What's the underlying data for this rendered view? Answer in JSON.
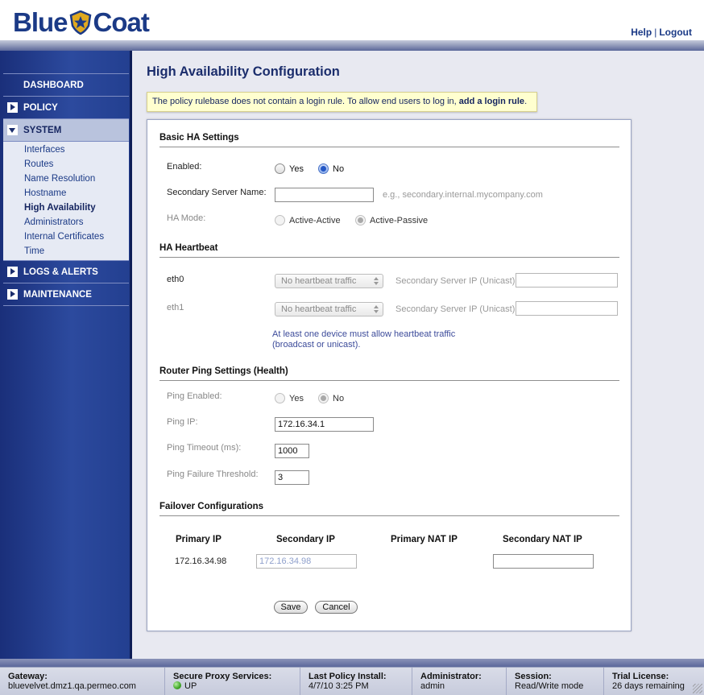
{
  "header": {
    "brand_part1": "Blue",
    "brand_part2": "Coat",
    "links": {
      "help": "Help",
      "separator": "|",
      "logout": "Logout"
    }
  },
  "sidebar": {
    "dashboard": "DASHBOARD",
    "policy": "POLICY",
    "system": "SYSTEM",
    "system_items": [
      "Interfaces",
      "Routes",
      "Name Resolution",
      "Hostname",
      "High Availability",
      "Administrators",
      "Internal Certificates",
      "Time"
    ],
    "current_item": "High Availability",
    "logs_alerts": "LOGS & ALERTS",
    "maintenance": "MAINTENANCE"
  },
  "page": {
    "title": "High Availability Configuration",
    "notice_text": "The policy rulebase does not contain a login rule. To allow end users to log in, ",
    "notice_link": "add a login rule",
    "notice_end": "."
  },
  "basic": {
    "title": "Basic HA Settings",
    "enabled_label": "Enabled:",
    "yes": "Yes",
    "no": "No",
    "enabled_value": "No",
    "secondary_label": "Secondary Server Name:",
    "secondary_value": "",
    "secondary_hint": "e.g., secondary.internal.mycompany.com",
    "mode_label": "HA Mode:",
    "mode_active_active": "Active-Active",
    "mode_active_passive": "Active-Passive",
    "mode_value": "Active-Passive"
  },
  "heartbeat": {
    "title": "HA Heartbeat",
    "eth0": "eth0",
    "eth1": "eth1",
    "select_value": "No heartbeat traffic",
    "secondary_ip_label": "Secondary Server IP (Unicast)",
    "note_line1": "At least one device must allow heartbeat traffic",
    "note_line2": "(broadcast or unicast)."
  },
  "router_ping": {
    "title": "Router Ping Settings (Health)",
    "enabled_label": "Ping Enabled:",
    "yes": "Yes",
    "no": "No",
    "enabled_value": "No",
    "ip_label": "Ping IP:",
    "ip_value": "172.16.34.1",
    "timeout_label": "Ping Timeout (ms):",
    "timeout_value": "1000",
    "threshold_label": "Ping Failure Threshold:",
    "threshold_value": "3"
  },
  "failover": {
    "title": "Failover Configurations",
    "columns": [
      "Primary IP",
      "Secondary IP",
      "Primary NAT IP",
      "Secondary NAT IP"
    ],
    "primary_ip": "172.16.34.98",
    "secondary_ip_placeholder": "172.16.34.98",
    "secondary_nat_value": ""
  },
  "buttons": {
    "save": "Save",
    "cancel": "Cancel"
  },
  "footer": {
    "gateway_label": "Gateway:",
    "gateway_value": "bluevelvet.dmz1.qa.permeo.com",
    "proxy_label": "Secure Proxy Services:",
    "proxy_value": "UP",
    "policy_label": "Last Policy Install:",
    "policy_value": "4/7/10 3:25 PM",
    "admin_label": "Administrator:",
    "admin_value": "admin",
    "session_label": "Session:",
    "session_value": "Read/Write mode",
    "trial_label": "Trial License:",
    "trial_value": "26 days remaining"
  },
  "colors": {
    "brand": "#1b3a86",
    "accent": "#2457c5",
    "status_up": "#3fa526"
  }
}
